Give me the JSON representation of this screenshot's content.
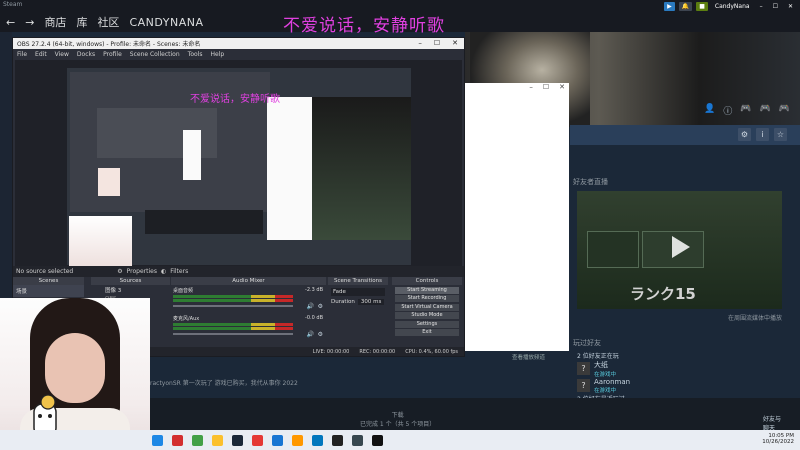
{
  "steam": {
    "top_label": "Steam",
    "nav": {
      "back": "←",
      "forward": "→",
      "store": "商店",
      "library": "库",
      "community": "社区",
      "username": "CANDYNANA"
    },
    "user_chip": "CandyNana",
    "overlay_title": "不爱说话，安静听歌",
    "friend_streams_title": "好友者直播",
    "stream_rank_label": "ランク15",
    "stream_card_caption": "在周围流媒体中播放",
    "white_window_caption": "查看播放频道",
    "news_line": "ractyonSR 第一次玩了 游戏已购买，我代从事你 2022",
    "friends_title": "玩过好友",
    "friends_playing_header": "2 位好友正在玩",
    "friends": [
      {
        "avatar": "?",
        "name": "大纸",
        "status": "在游戏中"
      },
      {
        "avatar": "?",
        "name": "Aaronman",
        "status": "在游戏中"
      }
    ],
    "friends_recent_header": "2 位好友最近玩过",
    "bottom_center_title": "下载",
    "bottom_center_sub": "已完成 1 个（共 5 个项目）",
    "bottom_right": "好友与\n聊天"
  },
  "obs": {
    "title": "OBS 27.2.4 (64-bit, windows) - Profile: 未命名 - Scenes: 未命名",
    "menu": [
      "File",
      "Edit",
      "View",
      "Docks",
      "Profile",
      "Scene Collection",
      "Tools",
      "Help"
    ],
    "nested_title": "不爱说话，安静听歌",
    "no_source": "No source selected",
    "properties": "Properties",
    "filters": "Filters",
    "docks": {
      "scenes": "Scenes",
      "sources": "Sources",
      "mixer": "Audio Mixer",
      "transitions": "Scene Transitions",
      "controls": "Controls"
    },
    "scene_item": "场景",
    "source_items": [
      "图像 3",
      "OBS"
    ],
    "mixer_rows": [
      {
        "name": "桌面音频",
        "value": "-2.3 dB"
      },
      {
        "name": "麦克风/Aux",
        "value": "-0.0 dB"
      }
    ],
    "transition": "Fade",
    "duration_label": "Duration",
    "duration_value": "300 ms",
    "controls": [
      "Start Streaming",
      "Start Recording",
      "Start Virtual Camera",
      "Studio Mode",
      "Settings",
      "Exit"
    ],
    "status": {
      "live": "LIVE: 00:00:00",
      "rec": "REC: 00:00:00",
      "cpu": "CPU: 0.4%, 60.00 fps"
    }
  },
  "taskbar": {
    "clock_time": "10:05 PM",
    "clock_date": "10/26/2022"
  },
  "colors": {
    "steam_bg": "#1b2838",
    "overlay_text": "#e040e0",
    "obs_bg": "#2b2e38"
  }
}
